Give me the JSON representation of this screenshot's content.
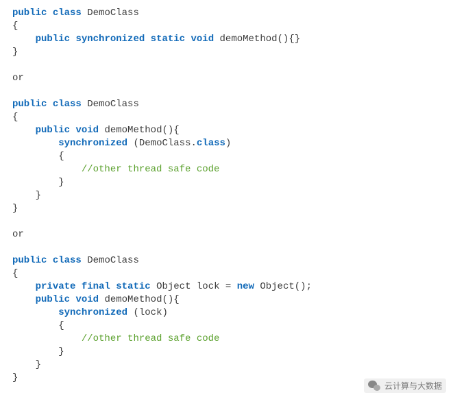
{
  "code": {
    "block1": {
      "l1_kw1": "public",
      "l1_kw2": "class",
      "l1_name": "DemoClass",
      "l2_open": "{",
      "l3_kw1": "public",
      "l3_kw2": "synchronized",
      "l3_kw3": "static",
      "l3_kw4": "void",
      "l3_name": "demoMethod",
      "l3_rest": "(){}",
      "l4_close": "}"
    },
    "or1": "or",
    "block2": {
      "l1_kw1": "public",
      "l1_kw2": "class",
      "l1_name": "DemoClass",
      "l2_open": "{",
      "l3_kw1": "public",
      "l3_kw2": "void",
      "l3_name": "demoMethod",
      "l3_rest": "(){",
      "l4_kw": "synchronized",
      "l4_pre": " (",
      "l4_target": "DemoClass",
      "l4_dot": ".",
      "l4_cls": "class",
      "l4_post": ")",
      "l5_open": "{",
      "l6_cmt": "//other thread safe code",
      "l7_close": "}",
      "l8_close": "}",
      "l9_close": "}"
    },
    "or2": "or",
    "block3": {
      "l1_kw1": "public",
      "l1_kw2": "class",
      "l1_name": "DemoClass",
      "l2_open": "{",
      "l3_kw1": "private",
      "l3_kw2": "final",
      "l3_kw3": "static",
      "l3_type": "Object",
      "l3_name": "lock",
      "l3_eq": " = ",
      "l3_kw4": "new",
      "l3_ctor": " Object();",
      "l4_kw1": "public",
      "l4_kw2": "void",
      "l4_name": "demoMethod",
      "l4_rest": "(){",
      "l5_kw": "synchronized",
      "l5_pre": " (",
      "l5_target": "lock",
      "l5_post": ")",
      "l6_open": "{",
      "l7_cmt": "//other thread safe code",
      "l8_close": "}",
      "l9_close": "}",
      "l10_close": "}"
    }
  },
  "watermark": {
    "text": "云计算与大数据"
  }
}
